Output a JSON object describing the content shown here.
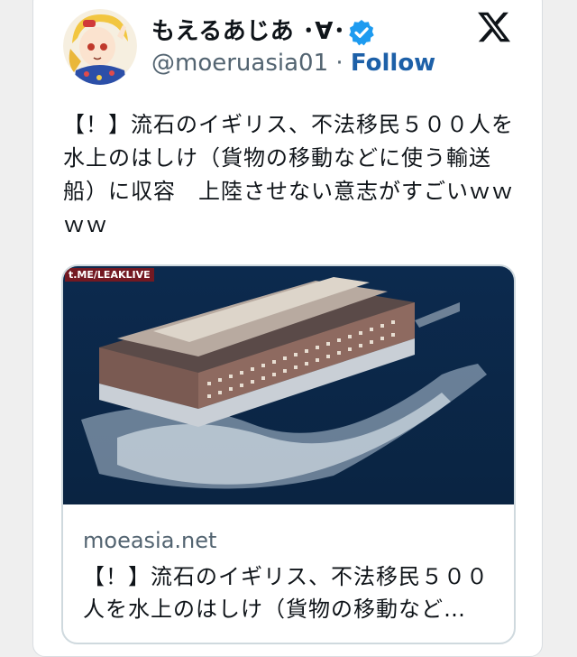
{
  "author": {
    "display_name": "もえるあじあ ･∀･",
    "handle": "@moeruasia01",
    "separator": "·",
    "follow_label": "Follow",
    "verified_color": "#1d9bf0"
  },
  "tweet": {
    "text": "【！】流石のイギリス、不法移民５００人を水上のはしけ（貨物の移動などに使う輸送船）に収容　上陸させない意志がすごいｗｗｗｗ"
  },
  "link_card": {
    "image_watermark": "t.ME/LEAKLIVE",
    "domain": "moeasia.net",
    "title": "【！】流石のイギリス、不法移民５００人を水上のはしけ（貨物の移動など…"
  },
  "icons": {
    "platform_logo": "x-logo-icon",
    "verified": "verified-badge-icon"
  }
}
